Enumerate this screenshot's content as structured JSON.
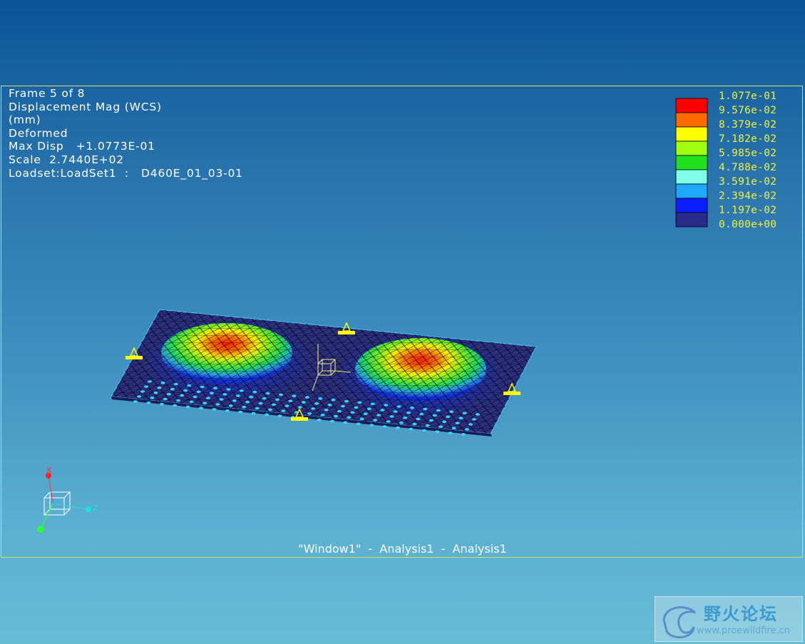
{
  "info_lines": [
    "Frame 5 of 8",
    "Displacement Mag (WCS)",
    "(mm)",
    "Deformed",
    "Max Disp   +1.0773E-01",
    "Scale  2.7440E+02",
    "Loadset:LoadSet1  :   D460E_01_03-01"
  ],
  "legend": {
    "labels": [
      "1.077e-01",
      "9.576e-02",
      "8.379e-02",
      "7.182e-02",
      "5.985e-02",
      "4.788e-02",
      "3.591e-02",
      "2.394e-02",
      "1.197e-02",
      "0.000e+00"
    ],
    "colors": [
      "#ff0000",
      "#ff6a00",
      "#ffff00",
      "#a0ff10",
      "#20e020",
      "#80ffe8",
      "#1ea8ff",
      "#0a1eff",
      "#2a2a8a"
    ],
    "label_color": "#f0f040"
  },
  "caption": "\"Window1\"  -  Analysis1  -  Analysis1",
  "triad": {
    "x_label": "X",
    "z_label": "Z"
  },
  "watermark": {
    "title": "野火论坛",
    "url": "www.proewildfire.cn"
  }
}
